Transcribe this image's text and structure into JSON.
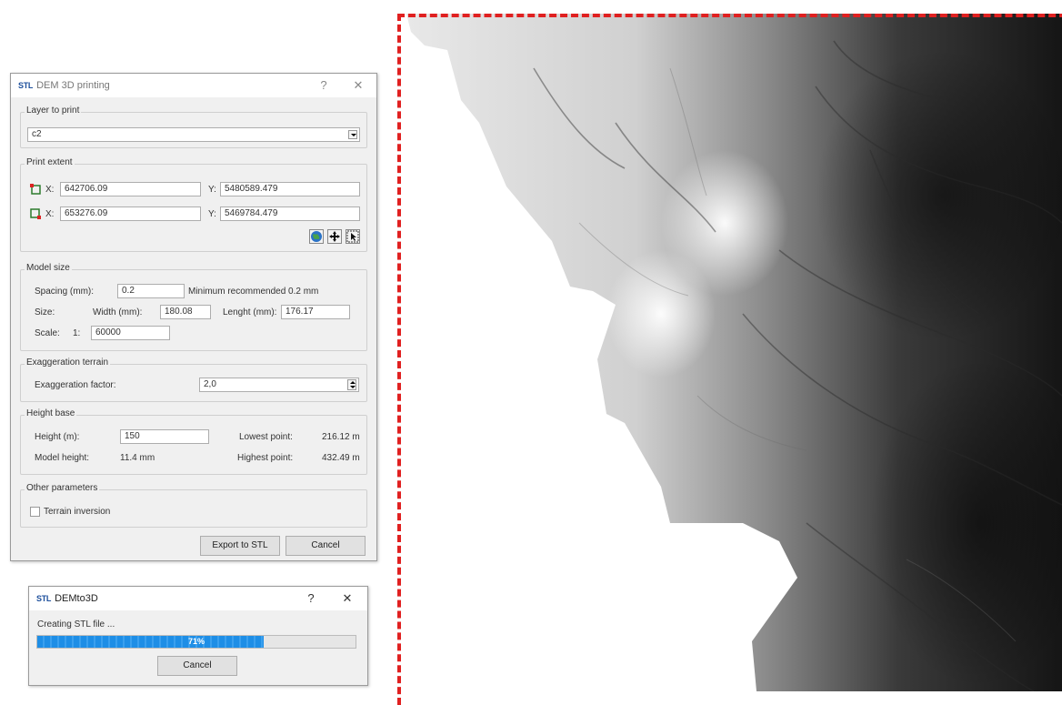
{
  "dialog": {
    "title": "DEM 3D printing",
    "logo": "STL",
    "help": "?",
    "close": "✕",
    "layer_group": "Layer to print",
    "layer_value": "c2",
    "extent_group": "Print extent",
    "x_label": "X:",
    "y_label": "Y:",
    "x1": "642706.09",
    "y1": "5480589.479",
    "x2": "653276.09",
    "y2": "5469784.479",
    "model_group": "Model size",
    "spacing_label": "Spacing (mm):",
    "spacing_value": "0.2",
    "min_recommended": "Minimum recommended 0.2 mm",
    "size_label": "Size:",
    "width_label": "Width (mm):",
    "width_value": "180.08",
    "length_label": "Lenght (mm):",
    "length_value": "176.17",
    "scale_label": "Scale:",
    "scale_prefix": "1:",
    "scale_value": "60000",
    "exag_group": "Exaggeration terrain",
    "exag_label": "Exaggeration factor:",
    "exag_value": "2,0",
    "height_group": "Height base",
    "height_label": "Height (m):",
    "height_value": "150",
    "lowest_label": "Lowest point:",
    "lowest_value": "216.12 m",
    "model_height_label": "Model height:",
    "model_height_value": "11.4 mm",
    "highest_label": "Highest point:",
    "highest_value": "432.49 m",
    "other_group": "Other parameters",
    "inversion_label": "Terrain inversion",
    "export_button": "Export to STL",
    "cancel_button": "Cancel"
  },
  "progress_dialog": {
    "logo": "STL",
    "title": "DEMto3D",
    "help": "?",
    "close": "✕",
    "status": "Creating STL file ...",
    "percent_text": "71%",
    "percent_value": 71,
    "cancel_button": "Cancel"
  },
  "colors": {
    "extent_border": "#e02020",
    "progress": "#1e8ee6",
    "logo": "#1d4f9c"
  }
}
